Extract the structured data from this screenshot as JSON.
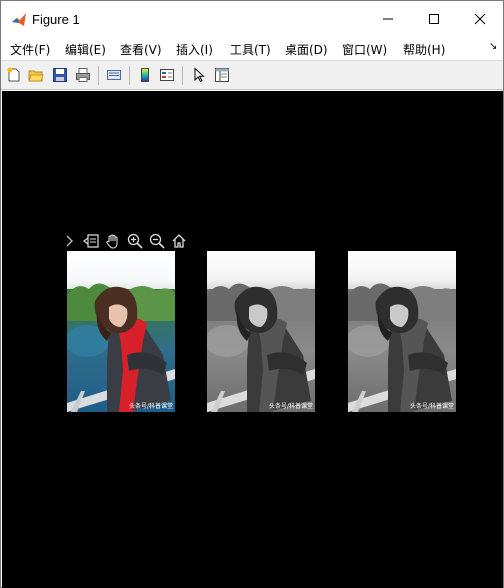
{
  "window": {
    "title": "Figure 1"
  },
  "menus": [
    {
      "label": "文件(F)"
    },
    {
      "label": "编辑(E)"
    },
    {
      "label": "查看(V)"
    },
    {
      "label": "插入(I)"
    },
    {
      "label": "工具(T)"
    },
    {
      "label": "桌面(D)"
    },
    {
      "label": "窗口(W)"
    },
    {
      "label": "帮助(H)"
    }
  ],
  "toolbar_icons": [
    "new-figure-icon",
    "open-file-icon",
    "save-icon",
    "print-icon",
    "link-plot-icon",
    "insert-colorbar-icon",
    "insert-legend-icon",
    "edit-plot-arrow-icon",
    "property-inspector-icon"
  ],
  "axes_toolbar_icons": [
    "expand-toolbar-icon",
    "data-tips-icon",
    "pan-hand-icon",
    "zoom-in-icon",
    "zoom-out-icon",
    "restore-view-icon"
  ],
  "images": [
    {
      "kind": "color",
      "watermark": "头条号/科普课堂"
    },
    {
      "kind": "grayscale",
      "watermark": "头条号/科普课堂"
    },
    {
      "kind": "grayscale",
      "watermark": "头条号/科普课堂"
    }
  ],
  "colors": {
    "canvas_bg": "#000000",
    "toolbar_bg": "#f0f0f0",
    "scarf_red": "#d8202a",
    "coat_dark": "#3a3d44"
  }
}
